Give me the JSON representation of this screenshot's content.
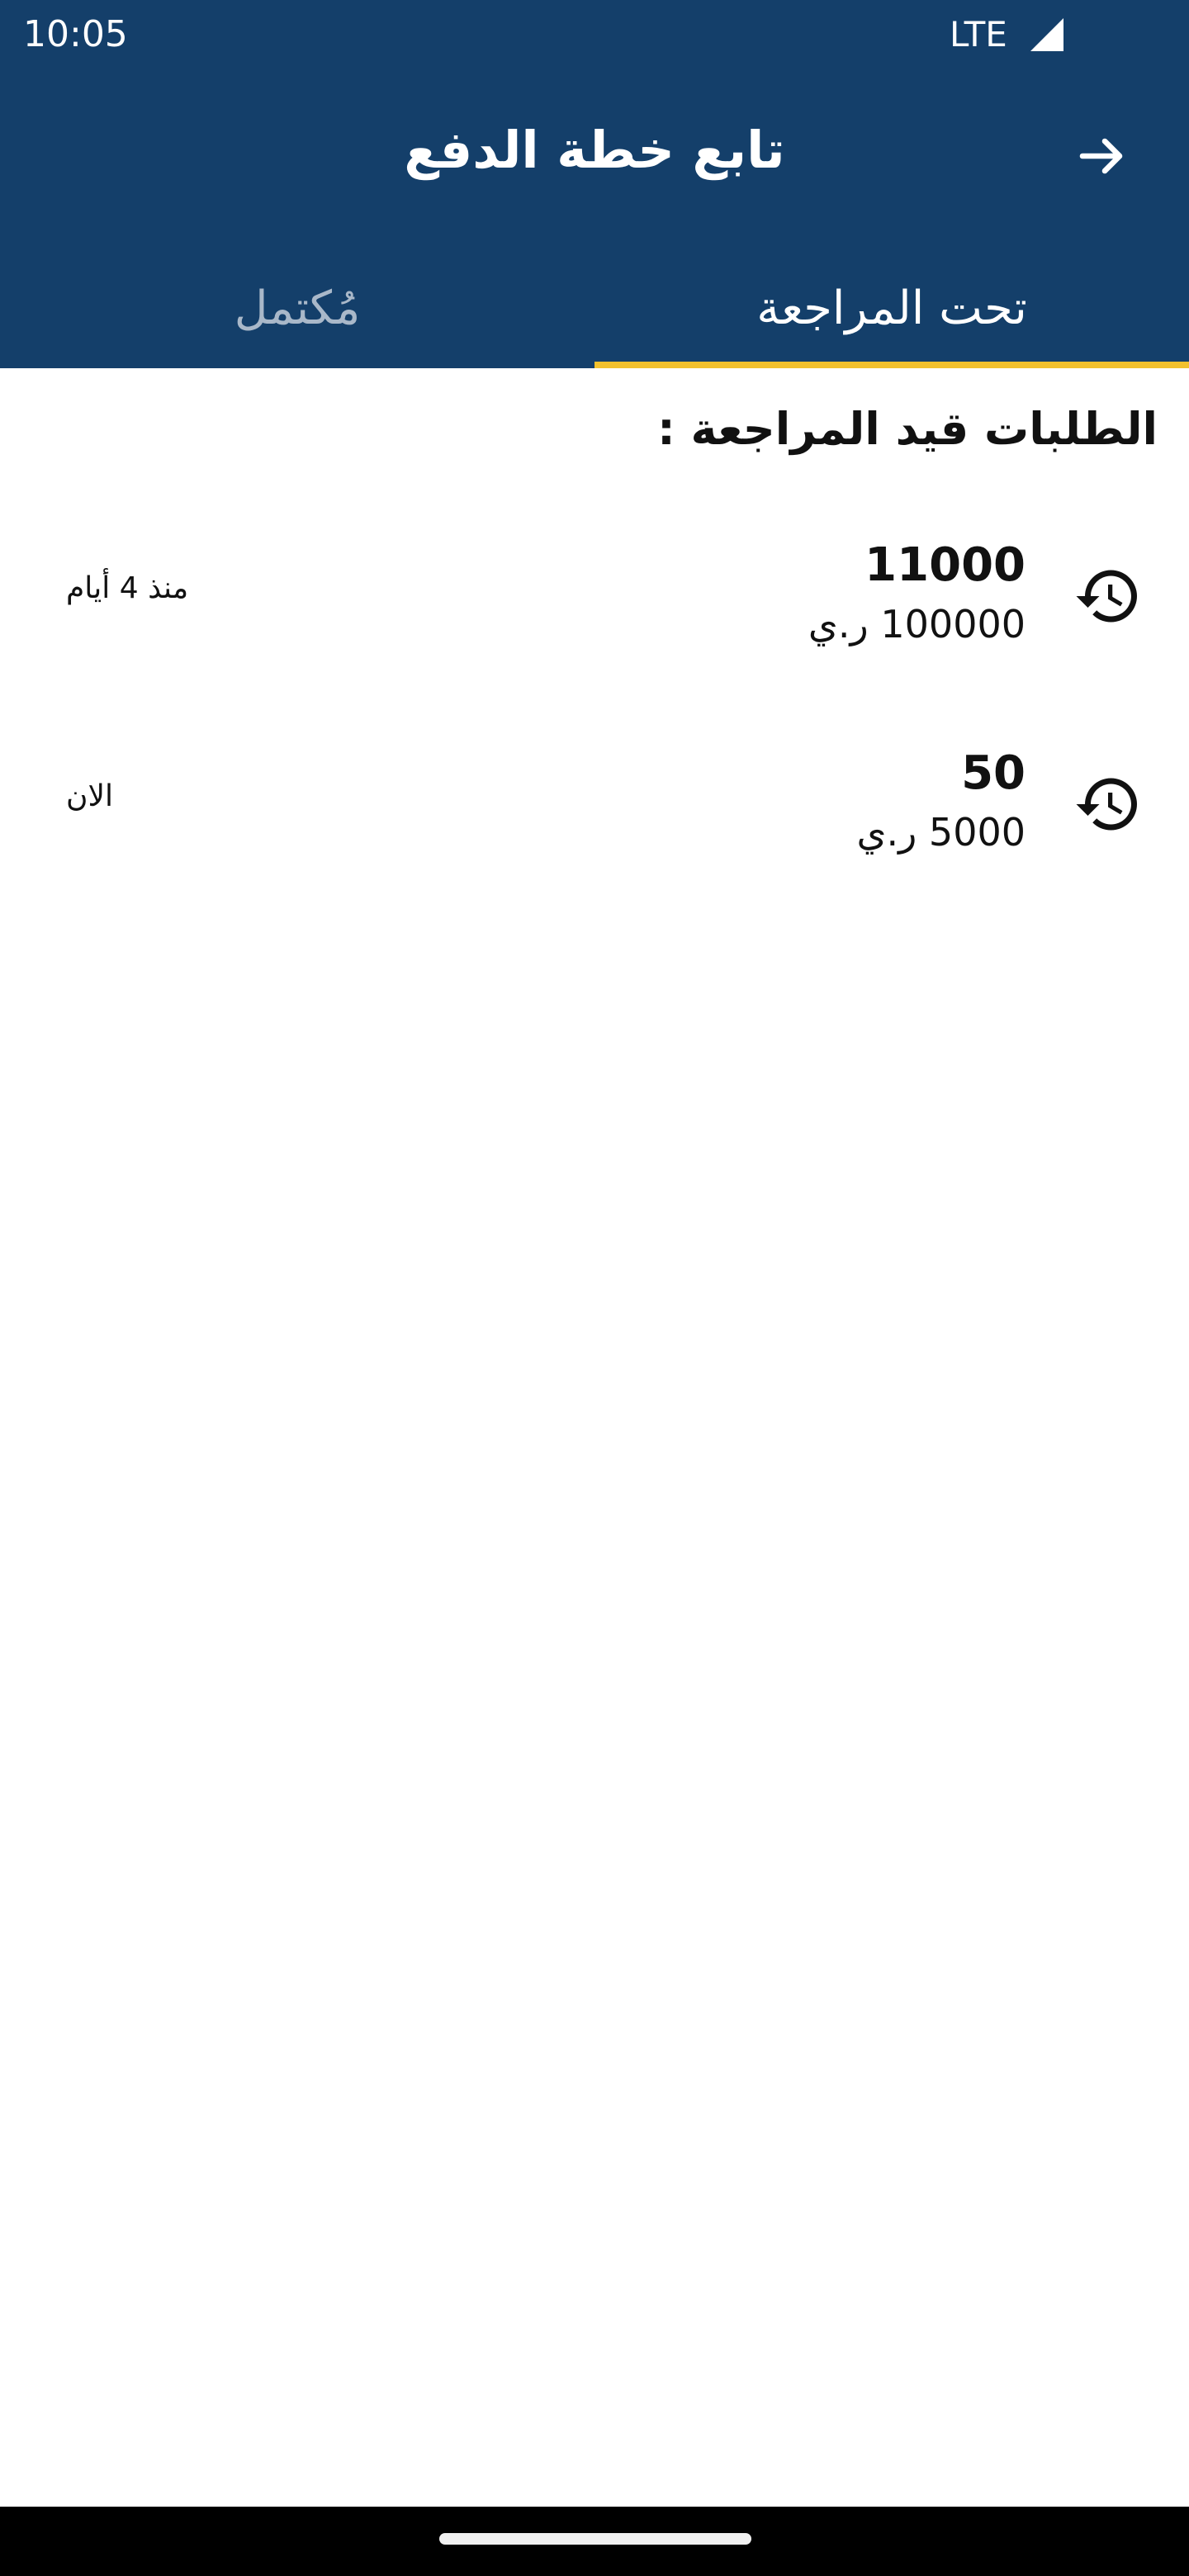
{
  "status_bar": {
    "time": "10:05",
    "network": "LTE"
  },
  "header": {
    "title": "تابع خطة الدفع",
    "back_icon": "arrow-right-icon"
  },
  "tabs": [
    {
      "label": "تحت المراجعة",
      "selected": true
    },
    {
      "label": "مُكتمل",
      "selected": false
    }
  ],
  "section": {
    "title": "الطلبات قيد المراجعة :"
  },
  "requests": [
    {
      "amount": "11000",
      "total": "100000 ر.ي",
      "time": "منذ 4 أيام",
      "icon": "history-icon"
    },
    {
      "amount": "50",
      "total": "5000 ر.ي",
      "time": "الان",
      "icon": "history-icon"
    }
  ],
  "colors": {
    "header_bg": "#143F6A",
    "tab_indicator": "#F2C12E",
    "tab_inactive": "#A9B8C9"
  }
}
